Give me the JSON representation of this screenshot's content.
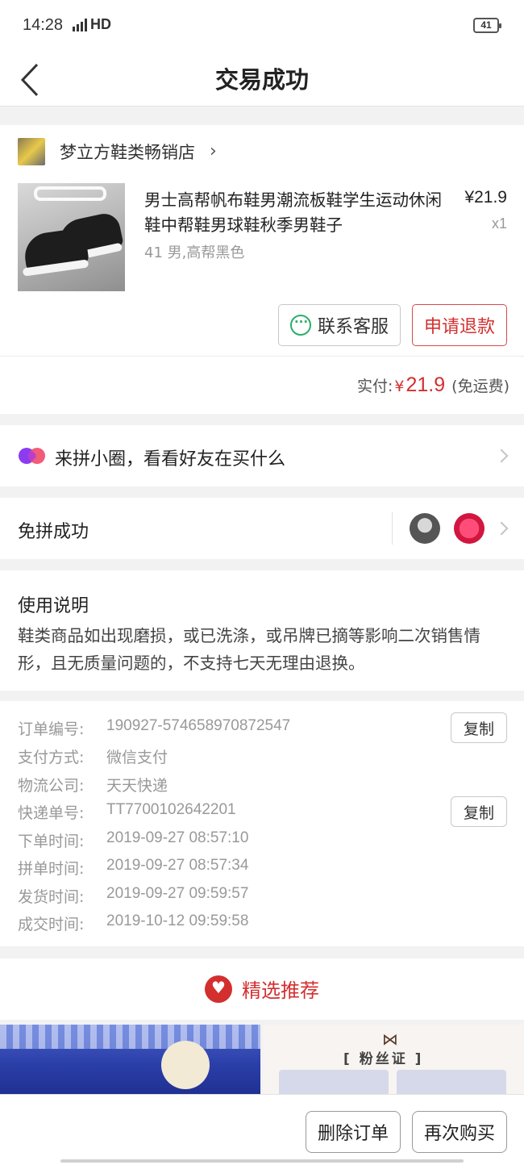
{
  "status_bar": {
    "time": "14:28",
    "network": "4G",
    "hd": "HD",
    "battery": "41"
  },
  "header": {
    "title": "交易成功"
  },
  "order": {
    "shop_name": "梦立方鞋类畅销店",
    "product_title": "男士高帮帆布鞋男潮流板鞋学生运动休闲鞋中帮鞋男球鞋秋季男鞋子",
    "price": "¥21.9",
    "quantity": "x1",
    "spec": "41 男,高帮黑色",
    "contact_label": "联系客服",
    "refund_label": "申请退款",
    "paid_label": "实付:",
    "paid_currency": "¥",
    "paid_amount": "21.9",
    "paid_note": "(免运费)"
  },
  "circle": {
    "label": "来拼小圈，看看好友在买什么"
  },
  "group": {
    "label": "免拼成功"
  },
  "usage": {
    "title": "使用说明",
    "text": "鞋类商品如出现磨损，或已洗涤，或吊牌已摘等影响二次销售情形，且无质量问题的，不支持七天无理由退换。"
  },
  "info": {
    "copy_label": "复制",
    "rows": [
      {
        "label": "订单编号:",
        "value": "190927-574658970872547"
      },
      {
        "label": "支付方式:",
        "value": "微信支付"
      },
      {
        "label": "物流公司:",
        "value": "天天快递"
      },
      {
        "label": "快递单号:",
        "value": "TT7700102642201"
      },
      {
        "label": "下单时间:",
        "value": "2019-09-27 08:57:10"
      },
      {
        "label": "拼单时间:",
        "value": "2019-09-27 08:57:34"
      },
      {
        "label": "发货时间:",
        "value": "2019-09-27 09:59:57"
      },
      {
        "label": "成交时间:",
        "value": "2019-10-12 09:59:58"
      }
    ]
  },
  "recommend": {
    "title": "精选推荐",
    "cert_text": "[ 粉丝证 ]"
  },
  "bottom": {
    "delete_label": "删除订单",
    "rebuy_label": "再次购买"
  },
  "colors": {
    "accent": "#d32f2f",
    "wechat": "#2aae67"
  }
}
